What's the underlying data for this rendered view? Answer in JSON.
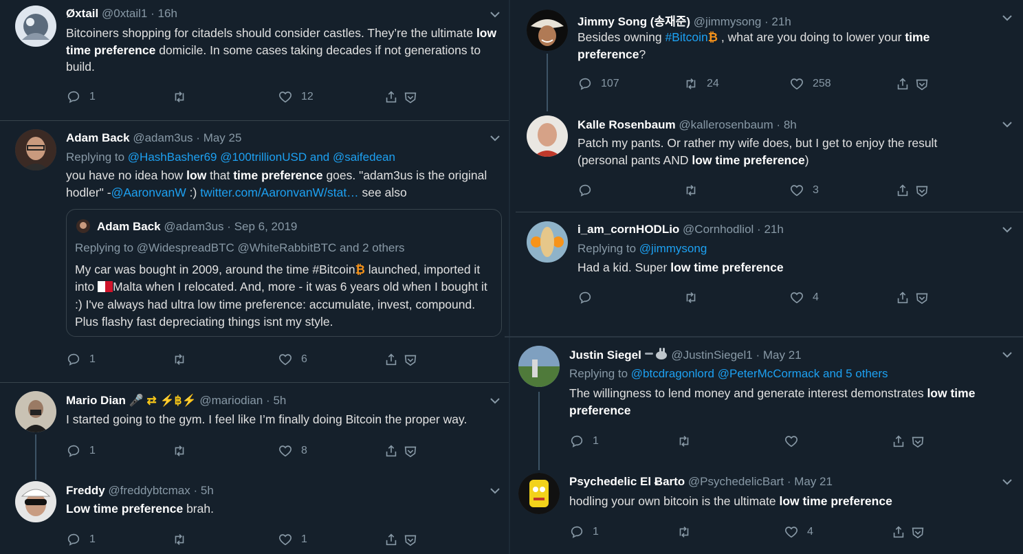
{
  "left": {
    "tweets": [
      {
        "name": "Øxtail",
        "handle": "@0xtail1",
        "time": "16h",
        "text": [
          "Bitcoiners shopping for citadels should consider castles. They’re the ultimate ",
          "low time preference",
          " domicile. In some cases taking decades if not generations to build."
        ],
        "replies": "1",
        "retweets": "",
        "likes": "12"
      },
      {
        "name": "Adam Back",
        "handle": "@adam3us",
        "time": "May 25",
        "replying_prefix": "Replying to ",
        "replying_to": "@HashBasher69 @100trillionUSD and @saifedean",
        "text_parts": [
          "you have no idea how ",
          "low",
          " that ",
          "time preference",
          " goes. \"adam3us is the original hodler\" -",
          "@AaronvanW",
          "  :) ",
          "twitter.com/AaronvanW/stat…",
          " see also"
        ],
        "quote": {
          "name": "Adam Back",
          "handle": "@adam3us",
          "time": "Sep 6, 2019",
          "replying": "Replying to @WidespreadBTC @WhiteRabbitBTC and 2 others",
          "text": [
            "My car was bought in 2009, around the time #Bitcoin",
            " launched, imported it into ",
            "Malta when I relocated. And, more - it was 6 years old when I bought it :) I've always had ultra low time preference: accumulate, invest, compound. Plus flashy fast depreciating things isnt my style."
          ]
        },
        "replies": "1",
        "retweets": "",
        "likes": "6"
      },
      {
        "name": "Mario Dian",
        "name_suffix": "🎤 ⇄ ⚡฿⚡",
        "handle": "@mariodian",
        "time": "5h",
        "text": "I started going to the gym. I feel like I’m finally doing Bitcoin the proper way.",
        "replies": "1",
        "retweets": "",
        "likes": "8"
      },
      {
        "name": "Freddy",
        "handle": "@freddybtcmax",
        "time": "5h",
        "text": [
          "Low time preference",
          " brah."
        ],
        "replies": "1",
        "retweets": "",
        "likes": "1"
      }
    ]
  },
  "right": {
    "tweets": [
      {
        "name": "Jimmy Song (송재준)",
        "handle": "@jimmysong",
        "time": "21h",
        "text": [
          "Besides owning ",
          "#Bitcoin",
          " , what are you doing to lower your ",
          "time preference",
          "?"
        ],
        "replies": "107",
        "retweets": "24",
        "likes": "258"
      },
      {
        "name": "Kalle Rosenbaum",
        "handle": "@kallerosenbaum",
        "time": "8h",
        "text": [
          "Patch my pants. Or rather my wife does, but I get to enjoy the result (personal pants AND ",
          "low time preference",
          ")"
        ],
        "replies": "",
        "retweets": "",
        "likes": "3"
      },
      {
        "name": "i_am_cornHODLio",
        "handle": "@Cornhodliol",
        "time": "21h",
        "replying_prefix": "Replying to ",
        "replying_to": "@jimmysong",
        "text": [
          "Had a kid.  Super ",
          "low time preference"
        ],
        "replies": "",
        "retweets": "",
        "likes": "4"
      },
      {
        "name": "Justin Siegel",
        "handle": "@JustinSiegel1",
        "time": "May 21",
        "replying_prefix": "Replying to ",
        "replying_to": "@btcdragonlord @PeterMcCormack and 5 others",
        "text": [
          "The willingness to lend money and generate interest demonstrates ",
          "low time preference"
        ],
        "replies": "1",
        "retweets": "",
        "likes": ""
      },
      {
        "name": "Psychedelic El Ƀarto",
        "handle": "@PsychedelicBart",
        "time": "May 21",
        "text": [
          "hodling your own bitcoin is the ultimate ",
          "low time preference"
        ],
        "replies": "1",
        "retweets": "",
        "likes": "4"
      }
    ]
  },
  "icons": {
    "reply": "reply-icon",
    "retweet": "retweet-icon",
    "like": "heart-icon",
    "share": "share-icon",
    "save": "bookmark-icon",
    "menu": "chevron-down-icon"
  },
  "colors": {
    "background": "#15202b",
    "link": "#1da1f2",
    "muted": "#8899a6",
    "bitcoin": "#f7931a"
  }
}
